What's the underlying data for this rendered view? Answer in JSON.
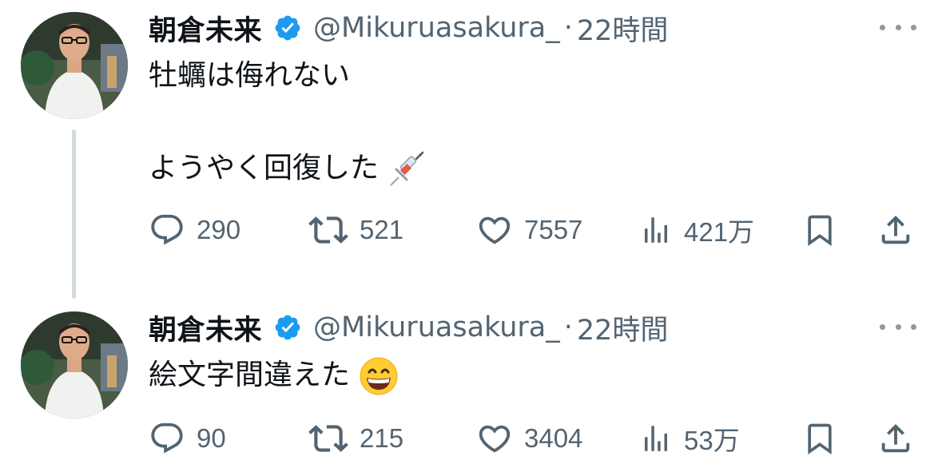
{
  "tweets": [
    {
      "display_name": "朝倉未来",
      "handle": "@Mikuruasakura_",
      "separator": "·",
      "time": "22時間",
      "text_line1": "牡蠣は侮れない",
      "text_line2": "ようやく回復した",
      "emoji": "syringe-emoji",
      "replies": "290",
      "retweets": "521",
      "likes": "7557",
      "views": "421万"
    },
    {
      "display_name": "朝倉未来",
      "handle": "@Mikuruasakura_",
      "separator": "·",
      "time": "22時間",
      "text_line1": "絵文字間違えた",
      "emoji": "grinning-face-emoji",
      "replies": "90",
      "retweets": "215",
      "likes": "3404",
      "views": "53万"
    }
  ],
  "colors": {
    "verified": "#1d9bf0",
    "secondary_text": "#536471",
    "thread_line": "#cfd9de",
    "primary_text": "#0f1419"
  }
}
